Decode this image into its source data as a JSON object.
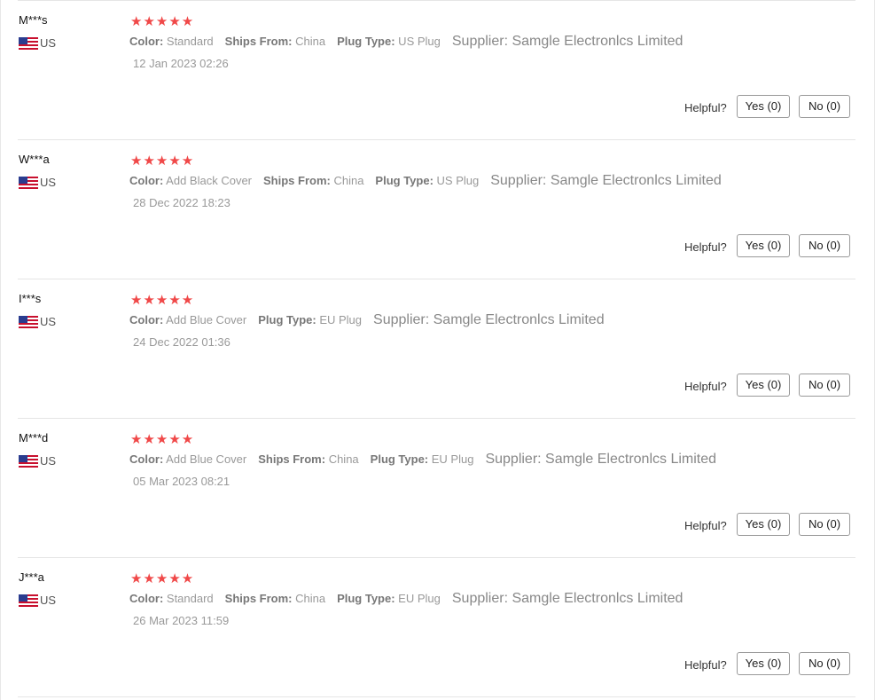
{
  "helpful_label": "Helpful?",
  "reviews": [
    {
      "name": "M***s",
      "country": "US",
      "rating": 5,
      "stars": "★★★★★",
      "attributes": [
        {
          "key": "Color:",
          "value": "Standard"
        },
        {
          "key": "Ships From:",
          "value": "China"
        },
        {
          "key": "Plug Type:",
          "value": "US Plug"
        }
      ],
      "supplier": "Supplier: Samgle Electronlcs Limited",
      "date": "12 Jan 2023 02:26",
      "yes": "Yes (0)",
      "no": "No (0)"
    },
    {
      "name": "W***a",
      "country": "US",
      "rating": 5,
      "stars": "★★★★★",
      "attributes": [
        {
          "key": "Color:",
          "value": "Add Black Cover"
        },
        {
          "key": "Ships From:",
          "value": "China"
        },
        {
          "key": "Plug Type:",
          "value": "US Plug"
        }
      ],
      "supplier": "Supplier: Samgle Electronlcs Limited",
      "date": "28 Dec 2022 18:23",
      "yes": "Yes (0)",
      "no": "No (0)"
    },
    {
      "name": "I***s",
      "country": "US",
      "rating": 5,
      "stars": "★★★★★",
      "attributes": [
        {
          "key": "Color:",
          "value": "Add Blue Cover"
        },
        {
          "key": "Plug Type:",
          "value": "EU Plug"
        }
      ],
      "supplier": "Supplier: Samgle Electronlcs Limited",
      "date": "24 Dec 2022 01:36",
      "yes": "Yes (0)",
      "no": "No (0)"
    },
    {
      "name": "M***d",
      "country": "US",
      "rating": 5,
      "stars": "★★★★★",
      "attributes": [
        {
          "key": "Color:",
          "value": "Add Blue Cover"
        },
        {
          "key": "Ships From:",
          "value": "China"
        },
        {
          "key": "Plug Type:",
          "value": "EU Plug"
        }
      ],
      "supplier": "Supplier: Samgle Electronlcs Limited",
      "date": "05 Mar 2023 08:21",
      "yes": "Yes (0)",
      "no": "No (0)"
    },
    {
      "name": "J***a",
      "country": "US",
      "rating": 5,
      "stars": "★★★★★",
      "attributes": [
        {
          "key": "Color:",
          "value": "Standard"
        },
        {
          "key": "Ships From:",
          "value": "China"
        },
        {
          "key": "Plug Type:",
          "value": "EU Plug"
        }
      ],
      "supplier": "Supplier: Samgle Electronlcs Limited",
      "date": "26 Mar 2023 11:59",
      "yes": "Yes (0)",
      "no": "No (0)"
    }
  ],
  "colors": {
    "star": "#f04848",
    "divider": "#e5e5e5"
  }
}
